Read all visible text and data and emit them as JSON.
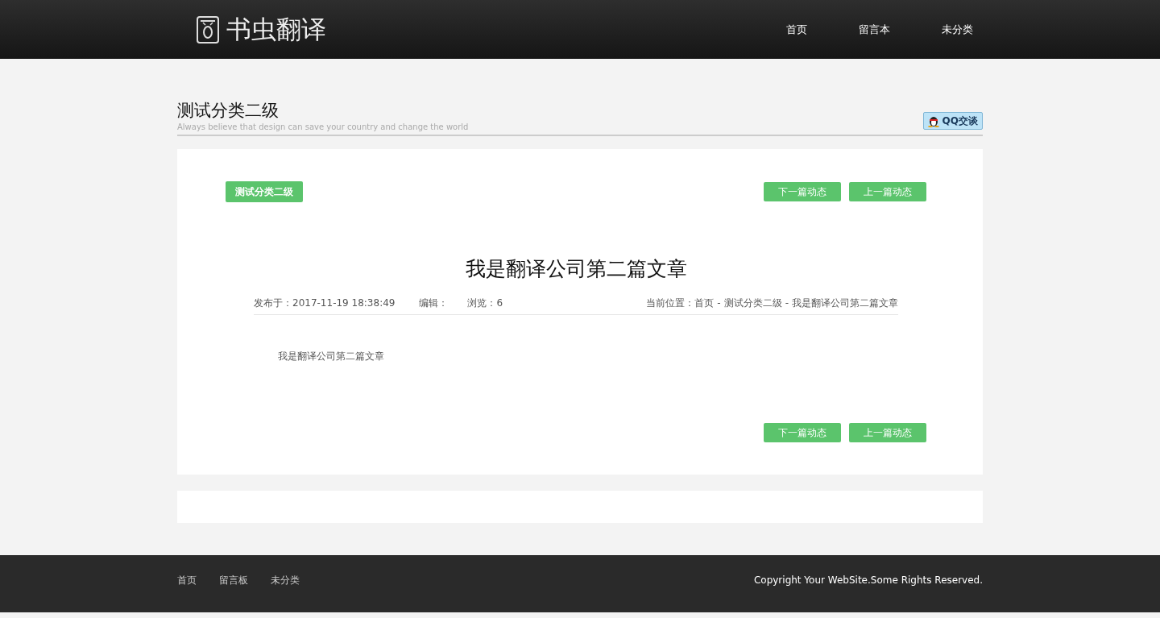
{
  "header": {
    "logo_text": "书虫翻译",
    "nav": [
      {
        "label": "首页"
      },
      {
        "label": "留言本"
      },
      {
        "label": "未分类"
      }
    ]
  },
  "page_title": {
    "title": "测试分类二级",
    "subtitle": "Always believe that design can save your country and change the world",
    "chat_button": "QQ交谈"
  },
  "article": {
    "category_tag": "测试分类二级",
    "top_buttons": [
      "下一篇动态",
      "上一篇动态"
    ],
    "title": "我是翻译公司第二篇文章",
    "meta": [
      "发布于：2017-11-19 18:38:49",
      "编辑：",
      "浏览：6"
    ],
    "breadcrumb": {
      "label": "当前位置：",
      "separator": "-",
      "items": [
        "首页",
        "测试分类二级",
        "我是翻译公司第二篇文章"
      ]
    },
    "body": "我是翻译公司第二篇文章",
    "bottom_buttons": [
      "下一篇动态",
      "上一篇动态"
    ]
  },
  "footer": {
    "links": [
      "首页",
      "留言板",
      "未分类"
    ],
    "copyright": "Copyright Your WebSite.Some Rights Reserved."
  }
}
